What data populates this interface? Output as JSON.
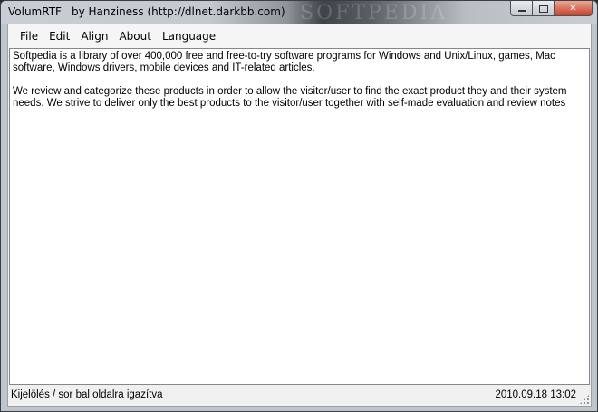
{
  "window": {
    "title": "VolumRTF",
    "author": "by Hanziness (http://dlnet.darkbb.com)",
    "watermark": "SOFTPEDIA",
    "controls": {
      "minimize": "minimize-icon",
      "maximize": "maximize-icon",
      "close": "close-icon",
      "close_glyph": "✕"
    },
    "colors": {
      "close_button": "#c8422a",
      "editor_bg": "#ffffff"
    }
  },
  "menu": {
    "items": [
      {
        "label": "File"
      },
      {
        "label": "Edit"
      },
      {
        "label": "Align"
      },
      {
        "label": "About"
      },
      {
        "label": "Language"
      }
    ]
  },
  "editor": {
    "paragraphs": [
      "Softpedia is a library of over 400,000 free and free-to-try software programs for Windows and Unix/Linux, games, Mac software, Windows drivers, mobile devices and IT-related articles.",
      "We review and categorize these products in order to allow the visitor/user to find the exact product they and their system needs. We strive to deliver only the best products to the visitor/user together with self-made evaluation and review notes"
    ]
  },
  "status": {
    "left": "Kijelölés / sor bal oldalra igazítva",
    "right": "2010.09.18 13:02"
  }
}
